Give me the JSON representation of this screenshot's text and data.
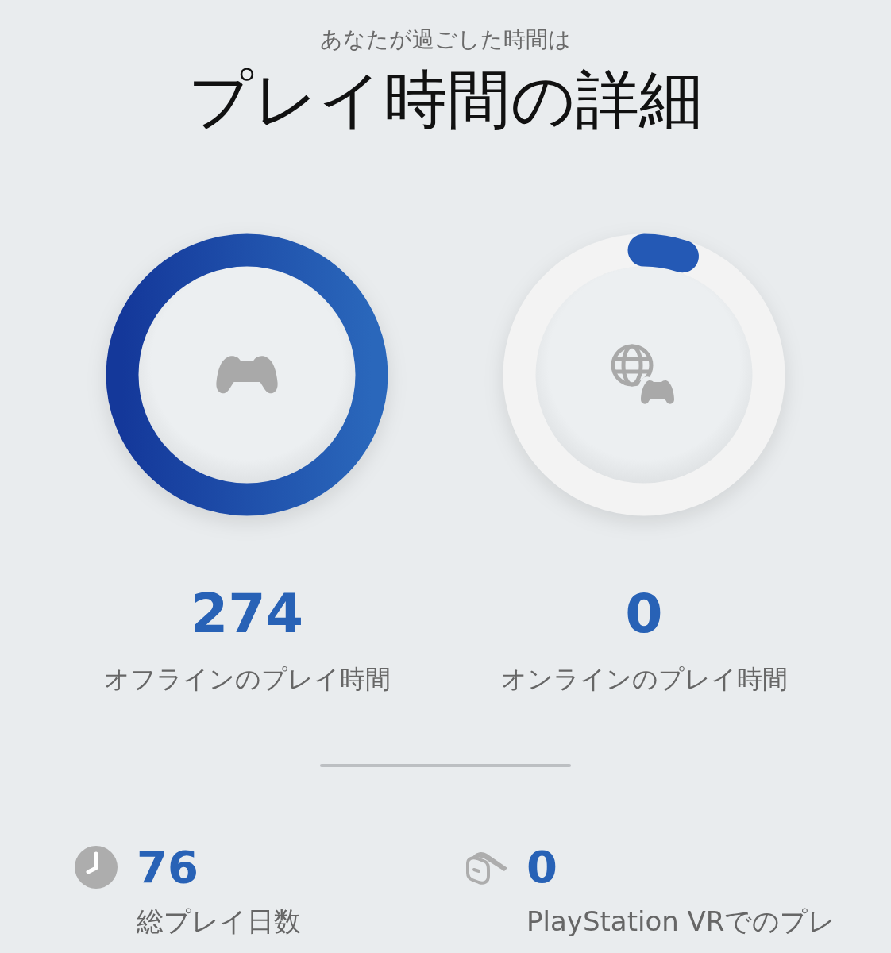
{
  "header": {
    "subtitle": "あなたが過ごした時間は",
    "title": "プレイ時間の詳細"
  },
  "rings": [
    {
      "kind": "offline",
      "level": 1,
      "value": "274",
      "label": "オフラインのプレイ時間"
    },
    {
      "kind": "online",
      "level": 0.05,
      "value": "0",
      "label": "オンラインのプレイ時間"
    }
  ],
  "stats": [
    {
      "kind": "days",
      "value": "76",
      "label": "総プレイ日数"
    },
    {
      "kind": "vr",
      "value": "0",
      "label": "PlayStation VRでのプレ"
    }
  ]
}
